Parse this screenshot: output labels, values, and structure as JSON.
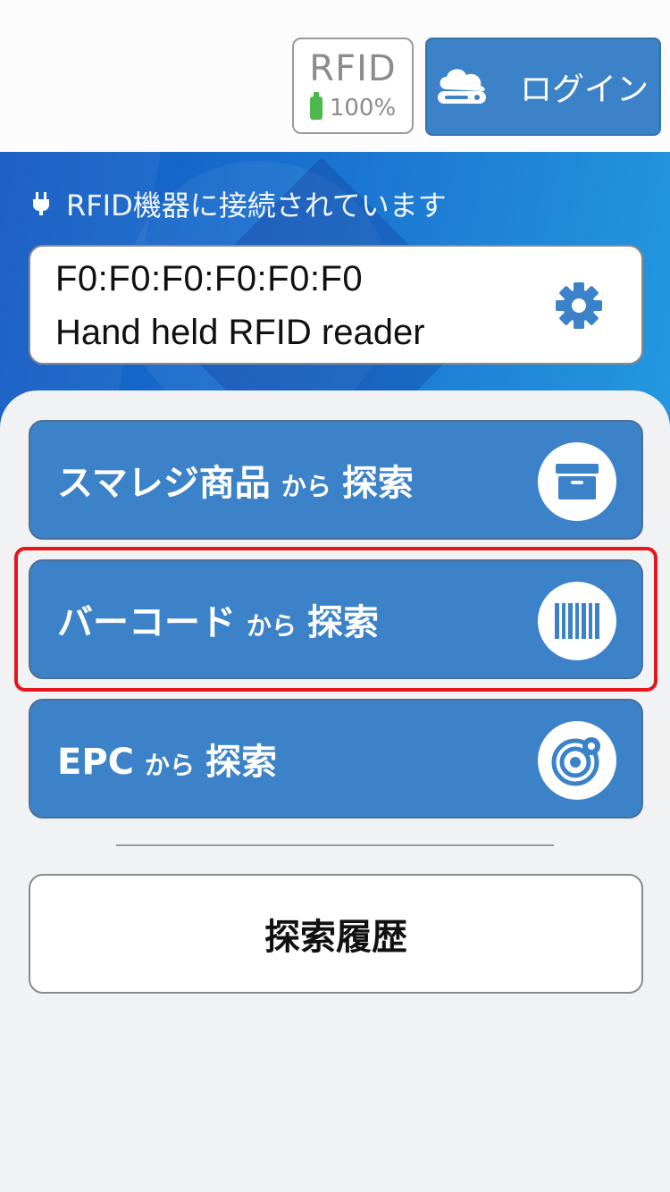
{
  "header": {
    "rfid_label": "RFID",
    "battery_percent": "100%",
    "battery_color": "#4db84d",
    "login_label": "ログイン",
    "login_icon": "cloud-drive-icon"
  },
  "connection": {
    "status_text": "RFID機器に接続されています",
    "status_icon": "plug-icon",
    "device_mac": "F0:F0:F0:F0:F0:F0",
    "device_name": "Hand held RFID reader",
    "settings_icon": "gear-icon"
  },
  "menu": {
    "items": [
      {
        "title": "スマレジ商品",
        "connector": "から",
        "action": "探索",
        "icon": "archive-box-icon"
      },
      {
        "title": "バーコード",
        "connector": "から",
        "action": "探索",
        "icon": "barcode-icon"
      },
      {
        "title": "EPC",
        "connector": "から",
        "action": "探索",
        "icon": "radar-target-icon"
      }
    ],
    "highlighted_index": 1,
    "history_label": "探索履歴"
  },
  "colors": {
    "accent": "#3b82c9",
    "highlight": "#e4161e"
  }
}
